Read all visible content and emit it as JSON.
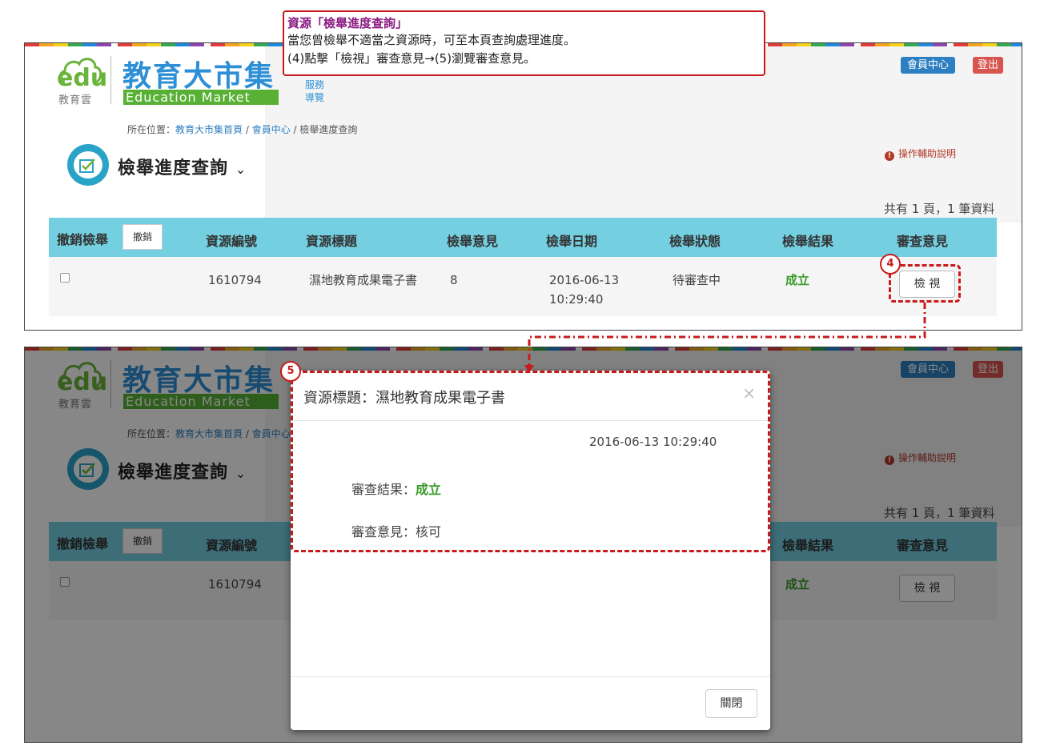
{
  "callout": {
    "title": "資源「檢舉進度查詢」",
    "line1": "當您曾檢舉不適當之資源時，可至本頁查詢處理進度。",
    "line2": "(4)點擊「檢視」審查意見→(5)瀏覽審查意見。"
  },
  "site": {
    "logo_edu": "edu",
    "logo_edu_sub": "教育雲",
    "logo_main": "教育大市集",
    "logo_en": "Education Market",
    "service_link": "服務",
    "nav_link": "導覽",
    "member_center": "會員中心",
    "logout": "登出"
  },
  "breadcrumb": {
    "prefix": "所在位置：",
    "home": "教育大市集首頁",
    "sep1": " / ",
    "member": "會員中心",
    "sep2": " / ",
    "current": "檢舉進度查詢"
  },
  "page": {
    "title": "檢舉進度查詢",
    "help": "操作輔助說明",
    "total": "共有 1 頁，1 筆資料"
  },
  "table": {
    "headers": [
      "撤銷檢舉",
      "資源編號",
      "資源標題",
      "檢舉意見",
      "檢舉日期",
      "檢舉狀態",
      "檢舉結果",
      "審查意見"
    ],
    "revoke_button": "撤銷",
    "row": {
      "id": "1610794",
      "title": "濕地教育成果電子書",
      "opinion": "8",
      "date": "2016-06-13",
      "time": "10:29:40",
      "status": "待審查中",
      "result": "成立",
      "view_button": "檢 視"
    }
  },
  "modal": {
    "title": "資源標題：濕地教育成果電子書",
    "datetime": "2016-06-13 10:29:40",
    "result_label": "審查結果：",
    "result_value": "成立",
    "opinion_label": "審查意見：",
    "opinion_value": "核可",
    "close_button": "關閉"
  },
  "steps": {
    "step4": "4",
    "step5": "5"
  },
  "colors": {
    "annotation_red": "#c81a1a",
    "table_header": "#74cfe0",
    "success_green": "#3a9a2a",
    "brand_blue": "#2d8fd6",
    "brand_green": "#58b135"
  }
}
